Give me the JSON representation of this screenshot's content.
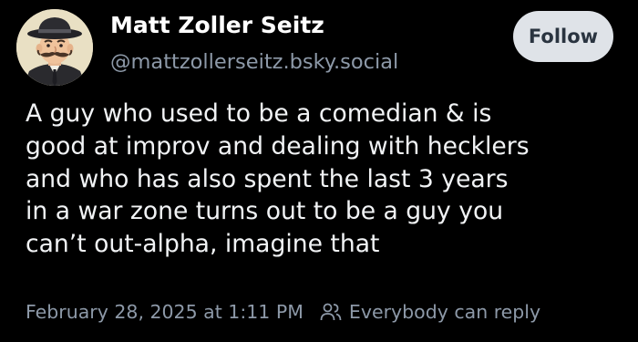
{
  "post": {
    "author": {
      "name": "Matt Zoller Seitz",
      "handle": "@mattzollerseitz.bsky.social",
      "avatar_icon": "cartoon-man-with-hat-and-mustache"
    },
    "follow_label": "Follow",
    "text_lines": [
      "A guy who used to be a comedian & is",
      "good at improv and dealing with hecklers",
      "and who has also spent the last 3 years",
      "in a war zone turns out to be a guy you",
      "can’t out-alpha, imagine that"
    ],
    "timestamp": "February 28, 2025 at 1:11 PM",
    "reply_setting": "Everybody can reply",
    "reply_icon": "people-icon"
  },
  "colors": {
    "background": "#000000",
    "primary_text": "#f1f3f5",
    "secondary_text": "#8d99a8",
    "follow_button_bg": "#dfe3e8",
    "follow_button_text": "#2a3440"
  }
}
